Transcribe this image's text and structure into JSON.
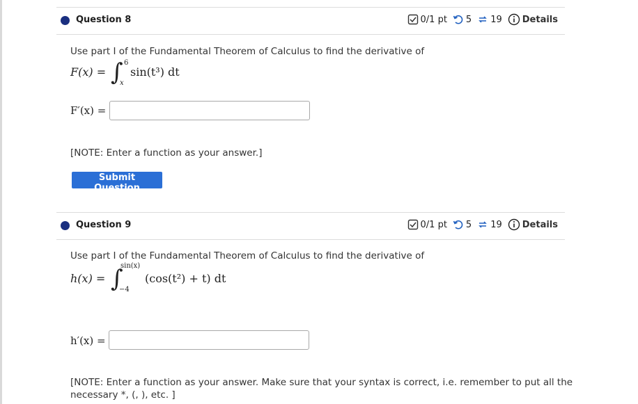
{
  "questions": [
    {
      "title": "Question 8",
      "score": "0/1 pt",
      "attempts": "5",
      "retries": "19",
      "details": "Details",
      "prompt": "Use part I of the Fundamental Theorem of Calculus to find the derivative of",
      "function_lhs": "F(x) =",
      "upper_limit": "6",
      "lower_limit": "x",
      "integrand": "sin(t³) dt",
      "answer_label": "F′(x) =",
      "answer_value": "",
      "note": "[NOTE: Enter a function as your answer.]",
      "submit_label": "Submit Question"
    },
    {
      "title": "Question 9",
      "score": "0/1 pt",
      "attempts": "5",
      "retries": "19",
      "details": "Details",
      "prompt": "Use part I of the Fundamental Theorem of Calculus to find the derivative of",
      "function_lhs": "h(x) =",
      "upper_limit": "sin(x)",
      "lower_limit": "−4",
      "integrand": "(cos(t²) + t) dt",
      "answer_label": "h′(x) =",
      "answer_value": "",
      "note_line1": "[NOTE: Enter a function as your answer. Make sure that your syntax is correct, i.e. remember to put all the",
      "note_line2": "necessary *, (, ), etc. ]"
    }
  ],
  "colors": {
    "accent": "#2b6fd6",
    "dot": "#1a2f80"
  }
}
